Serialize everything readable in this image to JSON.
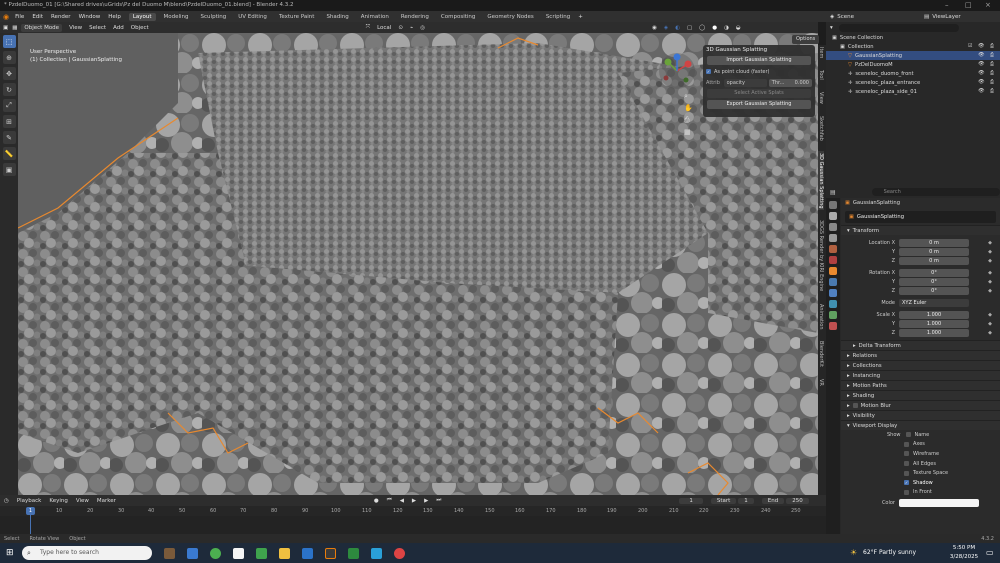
{
  "window": {
    "title": "* PzdelDuomo_01 [G:\\Shared drives\\uGrids\\Pz del Duomo M\\blend\\PzdelDuomo_01.blend] - Blender 4.3.2"
  },
  "menubar": {
    "menus": [
      "File",
      "Edit",
      "Render",
      "Window",
      "Help"
    ],
    "workspaces": [
      "Layout",
      "Modeling",
      "Sculpting",
      "UV Editing",
      "Texture Paint",
      "Shading",
      "Animation",
      "Rendering",
      "Compositing",
      "Geometry Nodes",
      "Scripting"
    ],
    "active_workspace": "Layout",
    "add_tab": "+",
    "scene": "Scene",
    "view_layer": "ViewLayer"
  },
  "viewport_header": {
    "mode": "Object Mode",
    "menus": [
      "View",
      "Select",
      "Add",
      "Object"
    ],
    "transform_orientation": "Local",
    "options": "Options"
  },
  "viewport": {
    "perspective": "User Perspective",
    "collection_line": "(1) Collection | GaussianSplatting"
  },
  "gaussian_panel": {
    "title": "3D Gaussian Splatting",
    "import_button": "Import Gaussian Splatting",
    "point_cloud_label": "As point cloud (faster)",
    "point_cloud_checked": true,
    "attrib_label": "Attrib",
    "attrib_value": "opacity",
    "threshold_label": "Thr...",
    "threshold_value": "0.000",
    "select_active_button": "Select Active Splats",
    "export_button": "Export Gaussian Splatting"
  },
  "side_tabs": [
    "Item",
    "Tool",
    "View",
    "Sketchfab",
    "3D Gaussian Splatting",
    "3DGS Render by KIRI Engine",
    "Animation",
    "BlenderKit",
    "VR"
  ],
  "timeline": {
    "menus": [
      "Playback",
      "Keying",
      "View",
      "Marker"
    ],
    "current_frame": "1",
    "start_label": "Start",
    "start_value": "1",
    "end_label": "End",
    "end_value": "250",
    "ruler": [
      "10",
      "20",
      "30",
      "40",
      "50",
      "60",
      "70",
      "80",
      "90",
      "100",
      "110",
      "120",
      "130",
      "140",
      "150",
      "160",
      "170",
      "180",
      "190",
      "200",
      "210",
      "220",
      "230",
      "240",
      "250"
    ],
    "playhead": "1"
  },
  "statusbar": {
    "items": [
      "Select",
      "Rotate View",
      "Object"
    ],
    "version": "4.3.2"
  },
  "outliner": {
    "header": "Scene Collection",
    "collection": "Collection",
    "items": [
      {
        "name": "GaussianSplatting",
        "selected": true
      },
      {
        "name": "PzDelDuomoM",
        "selected": false
      },
      {
        "name": "sceneloc_duomo_front",
        "selected": false
      },
      {
        "name": "sceneloc_plaza_entrance",
        "selected": false
      },
      {
        "name": "sceneloc_plaza_side_01",
        "selected": false
      }
    ]
  },
  "properties": {
    "search_placeholder": "Search",
    "object_breadcrumb": "GaussianSplatting",
    "object_name": "GaussianSplatting",
    "transform_title": "Transform",
    "location_label": "Location X",
    "location": [
      "0 m",
      "0 m",
      "0 m"
    ],
    "rotation_label": "Rotation X",
    "rotation": [
      "0°",
      "0°",
      "0°"
    ],
    "mode_label": "Mode",
    "mode_value": "XYZ Euler",
    "scale_label": "Scale X",
    "scale": [
      "1.000",
      "1.000",
      "1.000"
    ],
    "y_label": "Y",
    "z_label": "Z",
    "sections": [
      "Delta Transform",
      "Relations",
      "Collections",
      "Instancing",
      "Motion Paths",
      "Shading",
      "Motion Blur",
      "Visibility"
    ],
    "viewport_display_title": "Viewport Display",
    "show_label": "Show",
    "display_options": [
      {
        "label": "Name",
        "checked": false
      },
      {
        "label": "Axes",
        "checked": false
      },
      {
        "label": "Wireframe",
        "checked": false
      },
      {
        "label": "All Edges",
        "checked": false
      },
      {
        "label": "Texture Space",
        "checked": false
      },
      {
        "label": "Shadow",
        "checked": true
      },
      {
        "label": "In Front",
        "checked": false
      }
    ],
    "color_label": "Color"
  },
  "taskbar": {
    "search_placeholder": "Type here to search",
    "weather": "62°F  Partly sunny",
    "time": "5:50 PM",
    "date": "3/28/2025"
  },
  "colors": {
    "accent": "#4772b3",
    "selection_outline": "#e8892f",
    "mesh_grey": "#7a7a7a"
  }
}
